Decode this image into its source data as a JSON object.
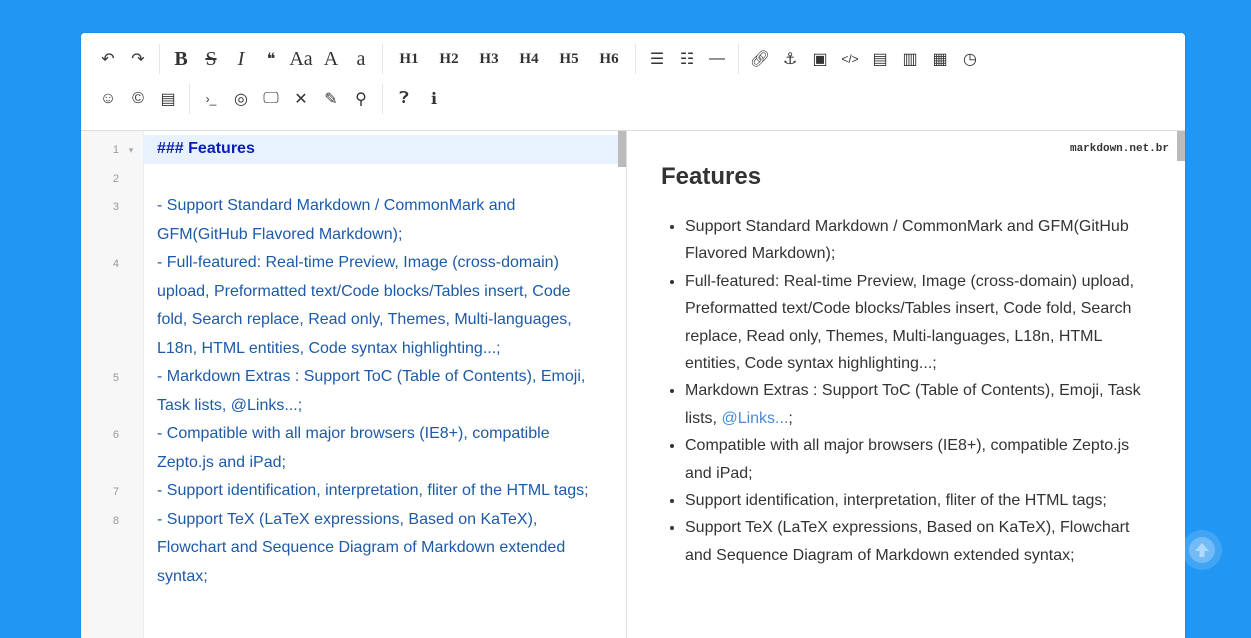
{
  "toolbar": {
    "row1": [
      {
        "group": "history",
        "items": [
          {
            "name": "undo-icon",
            "glyph": "↶"
          },
          {
            "name": "redo-icon",
            "glyph": "↷"
          }
        ]
      },
      {
        "group": "format",
        "items": [
          {
            "name": "bold-button",
            "glyph": "B",
            "style": "serif-bold"
          },
          {
            "name": "strikethrough-button",
            "glyph": "S",
            "style": "serif-strike"
          },
          {
            "name": "italic-button",
            "glyph": "I",
            "style": "serif-italic"
          },
          {
            "name": "quote-button",
            "glyph": "❝",
            "style": "plain"
          },
          {
            "name": "uppercase-button",
            "glyph": "Aa",
            "style": "serif"
          },
          {
            "name": "ucfirst-button",
            "glyph": "A",
            "style": "serif"
          },
          {
            "name": "lowercase-button",
            "glyph": "a",
            "style": "serif"
          }
        ]
      },
      {
        "group": "headings",
        "items": [
          {
            "name": "h1-button",
            "glyph": "H1",
            "style": "heading"
          },
          {
            "name": "h2-button",
            "glyph": "H2",
            "style": "heading"
          },
          {
            "name": "h3-button",
            "glyph": "H3",
            "style": "heading"
          },
          {
            "name": "h4-button",
            "glyph": "H4",
            "style": "heading"
          },
          {
            "name": "h5-button",
            "glyph": "H5",
            "style": "heading"
          },
          {
            "name": "h6-button",
            "glyph": "H6",
            "style": "heading"
          }
        ]
      },
      {
        "group": "lists",
        "items": [
          {
            "name": "unordered-list-icon",
            "glyph": "☰",
            "style": "plain"
          },
          {
            "name": "ordered-list-icon",
            "glyph": "☷",
            "style": "plain"
          },
          {
            "name": "horizontal-rule-icon",
            "glyph": "—",
            "style": "plain"
          }
        ]
      },
      {
        "group": "insert",
        "items": [
          {
            "name": "link-icon",
            "glyph": "🔗︎",
            "style": "plain"
          },
          {
            "name": "anchor-icon",
            "glyph": "⚓︎",
            "style": "plain"
          },
          {
            "name": "image-icon",
            "glyph": "▣",
            "style": "plain"
          },
          {
            "name": "code-icon",
            "glyph": "</>",
            "style": "small"
          },
          {
            "name": "code-block-icon",
            "glyph": "▤",
            "style": "plain"
          },
          {
            "name": "preformatted-text-icon",
            "glyph": "▥",
            "style": "plain"
          },
          {
            "name": "table-icon",
            "glyph": "▦",
            "style": "plain"
          },
          {
            "name": "datetime-icon",
            "glyph": "◷",
            "style": "plain"
          }
        ]
      }
    ],
    "row2": [
      {
        "group": "extras",
        "items": [
          {
            "name": "emoji-icon",
            "glyph": "☺",
            "style": "plain"
          },
          {
            "name": "html-entities-icon",
            "glyph": "©",
            "style": "plain"
          },
          {
            "name": "pagebreak-icon",
            "glyph": "▤",
            "style": "plain"
          }
        ]
      },
      {
        "group": "view",
        "items": [
          {
            "name": "goto-line-icon",
            "glyph": "›_",
            "style": "small"
          },
          {
            "name": "watch-toggle-icon",
            "glyph": "◎",
            "style": "plain"
          },
          {
            "name": "preview-icon",
            "glyph": "🖵︎",
            "style": "plain"
          },
          {
            "name": "fullscreen-icon",
            "glyph": "✕",
            "style": "plain"
          },
          {
            "name": "clear-icon",
            "glyph": "✎",
            "style": "plain"
          },
          {
            "name": "search-icon",
            "glyph": "⚲",
            "style": "plain"
          }
        ]
      },
      {
        "group": "help",
        "items": [
          {
            "name": "help-icon",
            "glyph": "❓︎",
            "style": "plain"
          },
          {
            "name": "info-icon",
            "glyph": "ℹ︎",
            "style": "plain"
          }
        ]
      }
    ]
  },
  "code": {
    "lines": [
      {
        "num": "1",
        "fold": "▾",
        "text": "### Features",
        "active": true
      },
      {
        "num": "2",
        "fold": "",
        "text": "",
        "active": false
      },
      {
        "num": "3",
        "fold": "",
        "text": "- Support Standard Markdown / CommonMark and GFM(GitHub Flavored Markdown);",
        "active": false
      },
      {
        "num": "4",
        "fold": "",
        "text": "- Full-featured: Real-time Preview, Image (cross-domain) upload, Preformatted text/Code blocks/Tables insert, Code fold, Search replace, Read only, Themes, Multi-languages, L18n, HTML entities, Code syntax highlighting...;",
        "active": false
      },
      {
        "num": "5",
        "fold": "",
        "text": "- Markdown Extras : Support ToC (Table of Contents), Emoji, Task lists, @Links...;",
        "active": false
      },
      {
        "num": "6",
        "fold": "",
        "text": "- Compatible with all major browsers (IE8+), compatible Zepto.js and iPad;",
        "active": false
      },
      {
        "num": "7",
        "fold": "",
        "text": "- Support identification, interpretation, fliter of the HTML tags;",
        "active": false
      },
      {
        "num": "8",
        "fold": "",
        "text": "- Support TeX (LaTeX expressions, Based on KaTeX), Flowchart and Sequence Diagram of Markdown extended syntax;",
        "active": false
      }
    ]
  },
  "preview": {
    "brand": "markdown.net.br",
    "heading": "Features",
    "items": [
      {
        "text": "Support Standard Markdown / CommonMark and GFM(GitHub Flavored Markdown);"
      },
      {
        "text": "Full-featured: Real-time Preview, Image (cross-domain) upload, Preformatted text/Code blocks/Tables insert, Code fold, Search replace, Read only, Themes, Multi-languages, L18n, HTML entities, Code syntax highlighting...;"
      },
      {
        "text": "Markdown Extras : Support ToC (Table of Contents), Emoji, Task lists, ",
        "link": "@Links...",
        "after": ";"
      },
      {
        "text": "Compatible with all major browsers (IE8+), compatible Zepto.js and iPad;"
      },
      {
        "text": "Support identification, interpretation, fliter of the HTML tags;"
      },
      {
        "text": "Support TeX (LaTeX expressions, Based on KaTeX), Flowchart and Sequence Diagram of Markdown extended syntax;"
      }
    ]
  },
  "colors": {
    "background": "#2196f3",
    "code_text": "#1d5aa8",
    "code_heading": "#0b1eb7",
    "link": "#4a8bd8"
  },
  "scroll_top_icon": "arrow-up-icon"
}
